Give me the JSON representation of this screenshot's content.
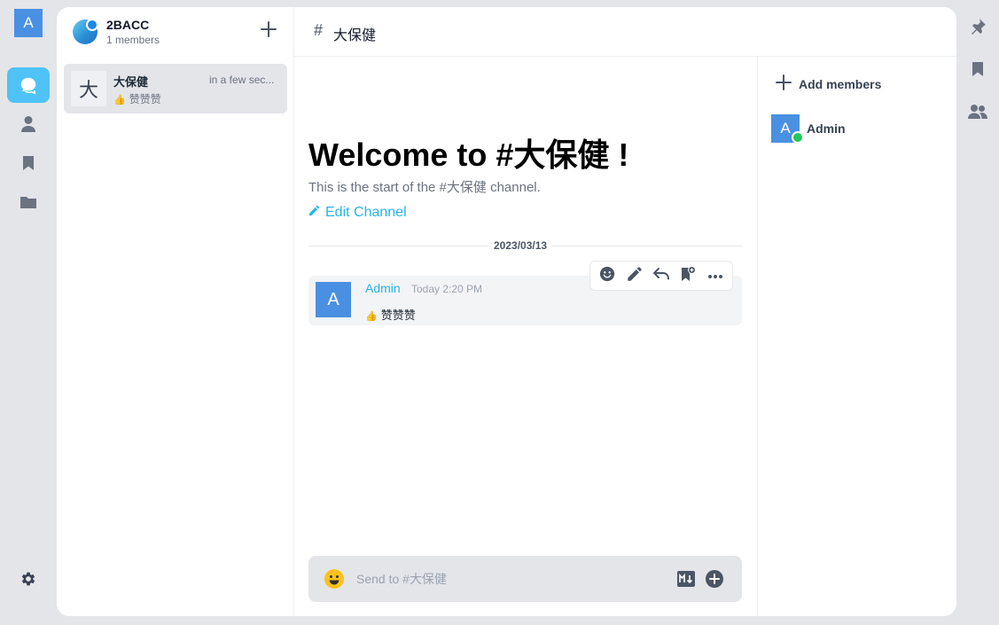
{
  "user": {
    "avatar_letter": "A"
  },
  "rail": {
    "items": [
      {
        "name": "chat",
        "icon": "chat-bubble-icon",
        "active": true
      },
      {
        "name": "contacts",
        "icon": "person-icon",
        "active": false
      },
      {
        "name": "bookmarks",
        "icon": "bookmark-icon",
        "active": false
      },
      {
        "name": "files",
        "icon": "folder-icon",
        "active": false
      }
    ],
    "settings_icon": "gear-icon"
  },
  "workspace": {
    "name": "2BACC",
    "members": "1 members"
  },
  "conversations": [
    {
      "avatar": "大",
      "name": "大保健",
      "time": "in a few sec...",
      "preview_icon": "👍",
      "preview": "赞赞赞"
    }
  ],
  "channel": {
    "hash": "#",
    "name": "大保健",
    "welcome": "Welcome to #大保健 !",
    "subtitle": "This is the start of the #大保健 channel.",
    "edit_label": "Edit Channel"
  },
  "messages": {
    "date_divider": "2023/03/13",
    "items": [
      {
        "avatar": "A",
        "author": "Admin",
        "time": "Today 2:20 PM",
        "icon": "👍",
        "text": "赞赞赞"
      }
    ]
  },
  "composer": {
    "placeholder": "Send to #大保健"
  },
  "members_panel": {
    "add_label": "Add members",
    "members": [
      {
        "avatar": "A",
        "name": "Admin",
        "status": "online"
      }
    ]
  },
  "colors": {
    "accent": "#26b5e6",
    "active_nav": "#4fc3f7",
    "avatar": "#4a90e2",
    "online": "#22c55e"
  }
}
